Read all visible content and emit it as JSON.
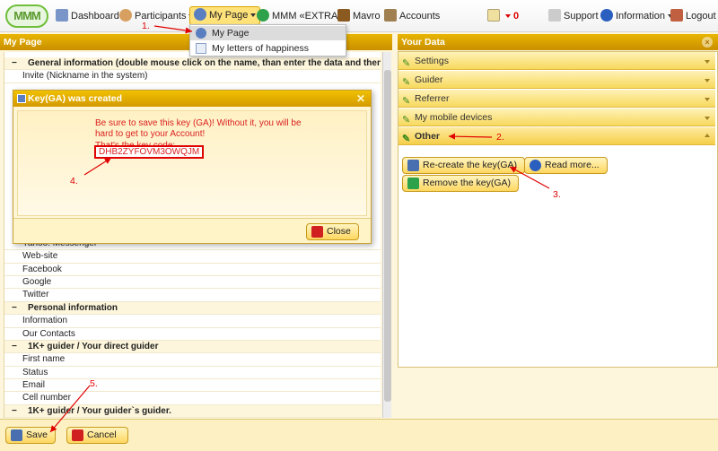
{
  "topbar": {
    "logo": "MMM",
    "items": [
      {
        "label": "Dashboard",
        "icon": "home-icon"
      },
      {
        "label": "Participants",
        "icon": "users-icon"
      },
      {
        "label": "My Page",
        "icon": "user-icon"
      },
      {
        "label": "MMM «EXTRA»",
        "icon": "extra-icon"
      },
      {
        "label": "Mavro",
        "icon": "mavro-icon"
      },
      {
        "label": "Accounts",
        "icon": "accounts-icon"
      },
      {
        "label": "0",
        "icon": "mail-icon"
      },
      {
        "label": "Support",
        "icon": "support-icon"
      },
      {
        "label": "Information",
        "icon": "info-icon"
      },
      {
        "label": "Logout",
        "icon": "logout-icon"
      }
    ]
  },
  "dropdown": {
    "items": [
      {
        "label": "My Page"
      },
      {
        "label": "My letters of happiness"
      }
    ]
  },
  "left_panel": {
    "title": "My Page",
    "rows": [
      {
        "label": "General information (double mouse click on the name, than enter the data and then \"Save\" d",
        "section": true
      },
      {
        "label": "Invite (Nickname in the system)",
        "section": false
      },
      {
        "label": "Yahoo! Messenger",
        "section": false
      },
      {
        "label": "Web-site",
        "section": false
      },
      {
        "label": "Facebook",
        "section": false
      },
      {
        "label": "Google",
        "section": false
      },
      {
        "label": "Twitter",
        "section": false
      },
      {
        "label": "Personal information",
        "section": true
      },
      {
        "label": "Information",
        "section": false
      },
      {
        "label": "Our Contacts",
        "section": false
      },
      {
        "label": "1K+ guider / Your direct guider",
        "section": true
      },
      {
        "label": "First name",
        "section": false
      },
      {
        "label": "Status",
        "section": false
      },
      {
        "label": "Email",
        "section": false
      },
      {
        "label": "Cell number",
        "section": false
      },
      {
        "label": "1K+ guider / Your guider`s guider.",
        "section": true
      }
    ]
  },
  "right_panel": {
    "title": "Your Data",
    "accordion": [
      "Settings",
      "Guider",
      "Referrer",
      "My mobile devices",
      "Other"
    ],
    "buttons": {
      "recreate": "Re-create the key(GA)",
      "read_more": "Read more...",
      "remove": "Remove the key(GA)"
    }
  },
  "dialog": {
    "title": "Key(GA) was created",
    "message": "Be sure to save this key (GA)! Without it, you will be hard to get to your Account!",
    "key_label": "That's the key code:",
    "key_code": "DHB2ZYFOVM3OWQJM",
    "close_label": "Close"
  },
  "bottombar": {
    "save_label": "Save",
    "cancel_label": "Cancel"
  },
  "annotations": [
    "1.",
    "2.",
    "3.",
    "4.",
    "5."
  ],
  "colors": {
    "accent": "#f0c000",
    "annotation": "#e00000",
    "panel_bg": "#fdf6dc"
  }
}
